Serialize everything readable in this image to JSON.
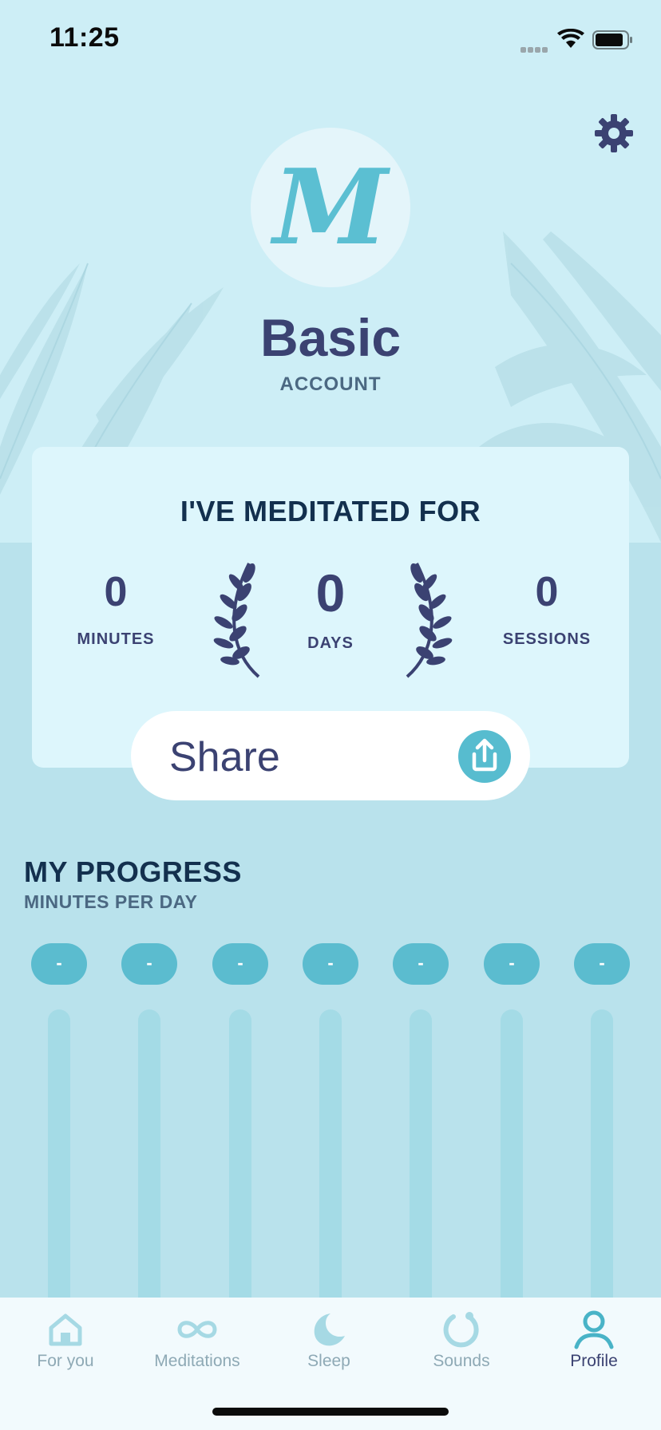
{
  "status_bar": {
    "time": "11:25"
  },
  "profile": {
    "avatar_letter": "M",
    "plan_title": "Basic",
    "plan_subtitle": "ACCOUNT"
  },
  "stats": {
    "heading": "I'VE MEDITATED FOR",
    "minutes": {
      "value": "0",
      "label": "MINUTES"
    },
    "days": {
      "value": "0",
      "label": "DAYS"
    },
    "sessions": {
      "value": "0",
      "label": "SESSIONS"
    }
  },
  "share": {
    "label": "Share"
  },
  "progress": {
    "title": "MY PROGRESS",
    "subtitle": "MINUTES PER DAY",
    "days": [
      {
        "value": "-"
      },
      {
        "value": "-"
      },
      {
        "value": "-"
      },
      {
        "value": "-"
      },
      {
        "value": "-"
      },
      {
        "value": "-"
      },
      {
        "value": "-"
      }
    ]
  },
  "tabs": [
    {
      "label": "For you",
      "icon": "home-icon",
      "active": false
    },
    {
      "label": "Meditations",
      "icon": "infinity-icon",
      "active": false
    },
    {
      "label": "Sleep",
      "icon": "moon-icon",
      "active": false
    },
    {
      "label": "Sounds",
      "icon": "sounds-icon",
      "active": false
    },
    {
      "label": "Profile",
      "icon": "profile-icon",
      "active": true
    }
  ],
  "colors": {
    "accent": "#57bccf",
    "navy": "#3b4272",
    "background": "#b9e2ec",
    "header_background": "#cdeef6"
  }
}
